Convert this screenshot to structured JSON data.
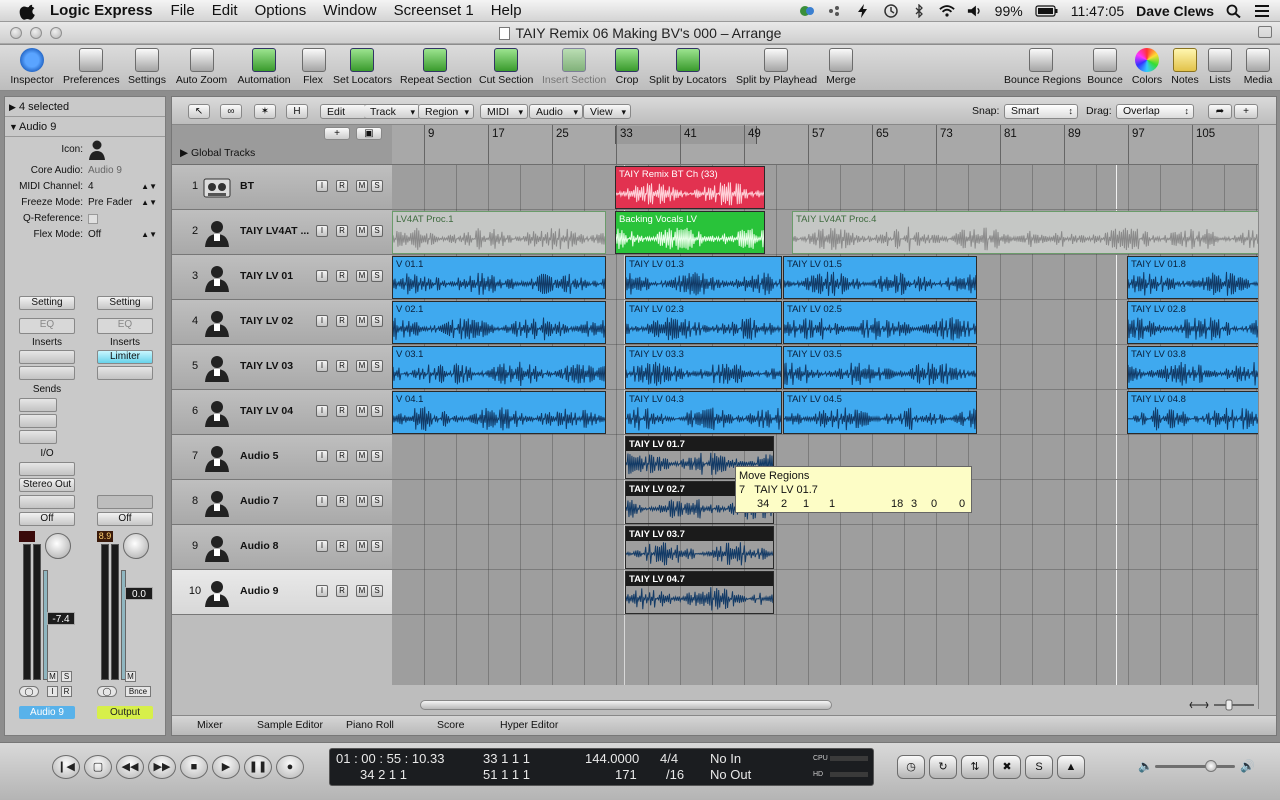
{
  "menubar": {
    "app_name": "Logic Express",
    "items": [
      "File",
      "Edit",
      "Options",
      "Window",
      "Screenset 1",
      "Help"
    ],
    "battery": "99%",
    "time": "11:47:05",
    "user": "Dave Clews"
  },
  "window": {
    "title": "TAIY Remix 06 Making BV's 000 – Arrange"
  },
  "toolbar": {
    "items": [
      {
        "label": "Inspector",
        "icon": "info-icon"
      },
      {
        "label": "Preferences",
        "icon": "preferences-icon"
      },
      {
        "label": "Settings",
        "icon": "settings-icon"
      },
      {
        "label": "Auto Zoom",
        "icon": "auto-zoom-icon"
      },
      {
        "label": "Automation",
        "icon": "automation-icon"
      },
      {
        "label": "Flex",
        "icon": "flex-icon"
      },
      {
        "label": "Set Locators",
        "icon": "set-locators-icon"
      },
      {
        "label": "Repeat Section",
        "icon": "repeat-section-icon"
      },
      {
        "label": "Cut Section",
        "icon": "cut-section-icon"
      },
      {
        "label": "Insert Section",
        "icon": "insert-section-icon"
      },
      {
        "label": "Crop",
        "icon": "crop-icon"
      },
      {
        "label": "Split by Locators",
        "icon": "split-locators-icon"
      },
      {
        "label": "Split by Playhead",
        "icon": "split-playhead-icon"
      },
      {
        "label": "Merge",
        "icon": "merge-icon"
      }
    ],
    "right_items": [
      {
        "label": "Bounce Regions",
        "icon": "bounce-regions-icon"
      },
      {
        "label": "Bounce",
        "icon": "bounce-icon"
      },
      {
        "label": "Colors",
        "icon": "colors-icon"
      },
      {
        "label": "Notes",
        "icon": "notes-icon"
      },
      {
        "label": "Lists",
        "icon": "lists-icon"
      },
      {
        "label": "Media",
        "icon": "media-icon"
      }
    ]
  },
  "inspector": {
    "selection": "4 selected",
    "track_name": "Audio 9",
    "icon_label": "Icon:",
    "rows": [
      {
        "label": "Core Audio:",
        "value": "Audio 9"
      },
      {
        "label": "MIDI Channel:",
        "value": "4"
      },
      {
        "label": "Freeze Mode:",
        "value": "Pre Fader"
      },
      {
        "label": "Q-Reference:",
        "value": ""
      },
      {
        "label": "Flex Mode:",
        "value": "Off"
      }
    ],
    "strip_left": {
      "setting": "Setting",
      "eq": "EQ",
      "inserts": "Inserts",
      "sends": "Sends",
      "io": "I/O",
      "output": "Stereo Out",
      "automation": "Off",
      "fader_value": "-7.4",
      "name": "Audio 9"
    },
    "strip_right": {
      "setting": "Setting",
      "eq": "EQ",
      "inserts": "Inserts",
      "insert_plugin": "Limiter",
      "automation": "Off",
      "peak": "8.9",
      "fader_value": "0.0",
      "bounce": "Bnce",
      "name": "Output"
    },
    "strip_buttons": {
      "mute": "M",
      "solo": "S",
      "input": "I",
      "record": "R"
    }
  },
  "arrange": {
    "local_menus": [
      "Edit",
      "Track",
      "Region",
      "MIDI",
      "Audio",
      "View"
    ],
    "h_button": "H",
    "snap_label": "Snap:",
    "snap_value": "Smart",
    "drag_label": "Drag:",
    "drag_value": "Overlap",
    "global_tracks": "Global Tracks",
    "ruler": [
      "9",
      "17",
      "25",
      "33",
      "41",
      "49",
      "57",
      "65",
      "73",
      "81",
      "89",
      "97",
      "105"
    ],
    "tracks": [
      {
        "no": "1",
        "name": "BT",
        "icon": "tape-deck-icon"
      },
      {
        "no": "2",
        "name": "TAIY LV4AT ...",
        "icon": "singer-icon"
      },
      {
        "no": "3",
        "name": "TAIY LV 01",
        "icon": "singer-icon"
      },
      {
        "no": "4",
        "name": "TAIY LV 02",
        "icon": "singer-icon"
      },
      {
        "no": "5",
        "name": "TAIY LV 03",
        "icon": "singer-icon"
      },
      {
        "no": "6",
        "name": "TAIY LV 04",
        "icon": "singer-icon"
      },
      {
        "no": "7",
        "name": "Audio 5",
        "icon": "singer-icon"
      },
      {
        "no": "8",
        "name": "Audio 7",
        "icon": "singer-icon"
      },
      {
        "no": "9",
        "name": "Audio 8",
        "icon": "singer-icon"
      },
      {
        "no": "10",
        "name": "Audio 9",
        "icon": "singer-icon"
      }
    ],
    "track_buttons": [
      "I",
      "R",
      "M",
      "S"
    ],
    "regions": [
      {
        "track": 0,
        "name": "TAIY Remix BT Ch (33)",
        "color": "red"
      },
      {
        "track": 1,
        "name": "LV4AT Proc.1",
        "color": "grey"
      },
      {
        "track": 1,
        "name": "Backing Vocals LV",
        "color": "green"
      },
      {
        "track": 1,
        "name": "TAIY LV4AT Proc.4",
        "color": "grey"
      },
      {
        "track": 2,
        "name": "V 01.1",
        "color": "blue"
      },
      {
        "track": 2,
        "name": "TAIY LV 01.3",
        "color": "blue"
      },
      {
        "track": 2,
        "name": "TAIY LV 01.5",
        "color": "blue"
      },
      {
        "track": 2,
        "name": "TAIY LV 01.8",
        "color": "blue"
      },
      {
        "track": 3,
        "name": "V 02.1",
        "color": "blue"
      },
      {
        "track": 3,
        "name": "TAIY LV 02.3",
        "color": "blue"
      },
      {
        "track": 3,
        "name": "TAIY LV 02.5",
        "color": "blue"
      },
      {
        "track": 3,
        "name": "TAIY LV 02.8",
        "color": "blue"
      },
      {
        "track": 4,
        "name": "V 03.1",
        "color": "blue"
      },
      {
        "track": 4,
        "name": "TAIY LV 03.3",
        "color": "blue"
      },
      {
        "track": 4,
        "name": "TAIY LV 03.5",
        "color": "blue"
      },
      {
        "track": 4,
        "name": "TAIY LV 03.8",
        "color": "blue"
      },
      {
        "track": 5,
        "name": "V 04.1",
        "color": "blue"
      },
      {
        "track": 5,
        "name": "TAIY LV 04.3",
        "color": "blue"
      },
      {
        "track": 5,
        "name": "TAIY LV 04.5",
        "color": "blue"
      },
      {
        "track": 5,
        "name": "TAIY LV 04.8",
        "color": "blue"
      },
      {
        "track": 6,
        "name": "TAIY LV 01.7",
        "color": "dark"
      },
      {
        "track": 7,
        "name": "TAIY LV 02.7",
        "color": "dark"
      },
      {
        "track": 8,
        "name": "TAIY LV 03.7",
        "color": "dark"
      },
      {
        "track": 9,
        "name": "TAIY LV 04.7",
        "color": "dark"
      }
    ],
    "tooltip": {
      "title": "Move Regions",
      "track_no": "7",
      "region": "TAIY LV 01.7",
      "position": [
        "34",
        "2",
        "1",
        "1"
      ],
      "length": [
        "18",
        "3",
        "0",
        "0"
      ]
    },
    "bottom_tabs": [
      "Mixer",
      "Sample Editor",
      "Piano Roll",
      "Score",
      "Hyper Editor"
    ]
  },
  "transport": {
    "smpte": "01 : 00 : 55 : 10.33",
    "bars_beats": "34   2   1     1",
    "left_loc": "33   1   1     1",
    "right_loc": "51   1   1     1",
    "tempo": "144.0000",
    "division": "171",
    "sig": "4/4",
    "sig2": "/16",
    "in": "No In",
    "out": "No Out",
    "cpu": "CPU",
    "hd": "HD"
  }
}
